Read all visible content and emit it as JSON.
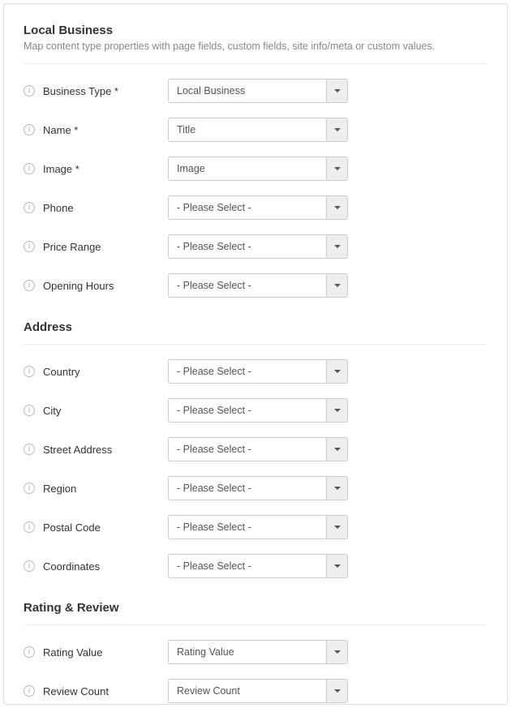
{
  "page": {
    "title": "Local Business",
    "subtitle": "Map content type properties with page fields, custom fields, site info/meta or custom values."
  },
  "placeholder": "- Please Select -",
  "sections": {
    "main": {
      "heading": "Local Business",
      "fields": {
        "business_type": {
          "label": "Business Type *",
          "value": "Local Business"
        },
        "name": {
          "label": "Name *",
          "value": "Title"
        },
        "image": {
          "label": "Image *",
          "value": "Image"
        },
        "phone": {
          "label": "Phone",
          "value": "- Please Select -"
        },
        "price_range": {
          "label": "Price Range",
          "value": "- Please Select -"
        },
        "opening_hours": {
          "label": "Opening Hours",
          "value": "- Please Select -"
        }
      }
    },
    "address": {
      "heading": "Address",
      "fields": {
        "country": {
          "label": "Country",
          "value": "- Please Select -"
        },
        "city": {
          "label": "City",
          "value": "- Please Select -"
        },
        "street_address": {
          "label": "Street Address",
          "value": "- Please Select -"
        },
        "region": {
          "label": "Region",
          "value": "- Please Select -"
        },
        "postal_code": {
          "label": "Postal Code",
          "value": "- Please Select -"
        },
        "coordinates": {
          "label": "Coordinates",
          "value": "- Please Select -"
        }
      }
    },
    "rating": {
      "heading": "Rating & Review",
      "fields": {
        "rating_value": {
          "label": "Rating Value",
          "value": "Rating Value"
        },
        "review_count": {
          "label": "Review Count",
          "value": "Review Count"
        }
      }
    }
  }
}
